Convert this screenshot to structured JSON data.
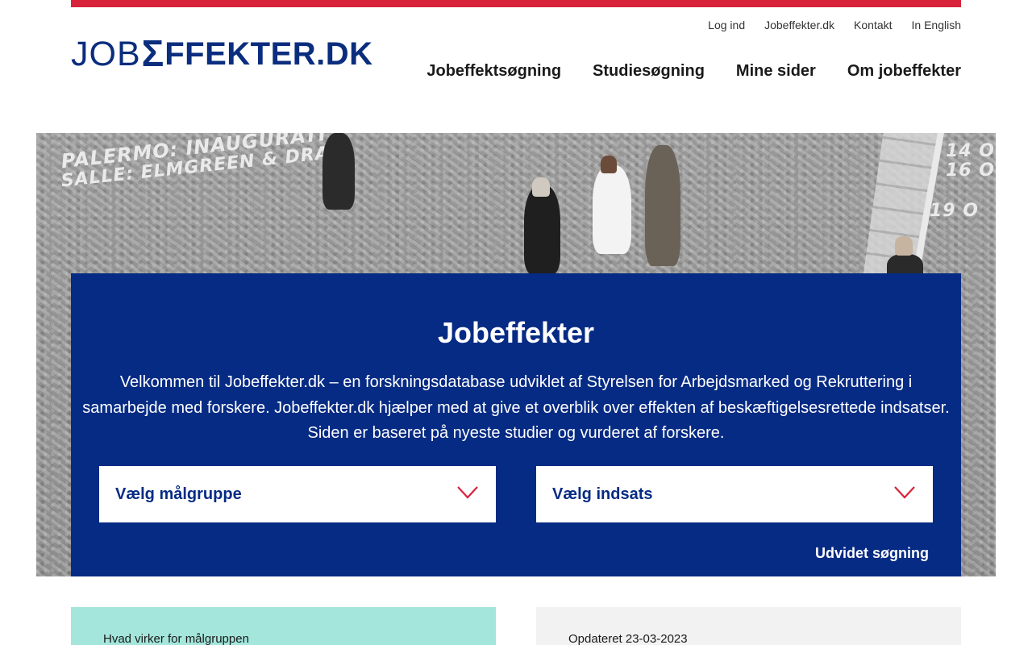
{
  "header": {
    "logo": {
      "part1": "JOB",
      "part2": "Σ",
      "part3": "FFEKTER.DK"
    },
    "util_nav": [
      "Log ind",
      "Jobeffekter.dk",
      "Kontakt",
      "In English"
    ],
    "main_nav": [
      "Jobeffektsøgning",
      "Studiesøgning",
      "Mine sider",
      "Om jobeffekter"
    ]
  },
  "hero": {
    "image_text": {
      "line1": "PALERMO: INAUGURATI",
      "line2": "SALLE: ELMGREEN & DRA",
      "r1": "14 O",
      "r2": "16 O",
      "r3": "19 O"
    },
    "title": "Jobeffekter",
    "intro": "Velkommen til Jobeffekter.dk – en forskningsdatabase udviklet af Styrelsen for Arbejdsmarked og Rekruttering i samarbejde med forskere. Jobeffekter.dk hjælper med at give et overblik over effekten af beskæftigelsesrettede indsatser. Siden er baseret på nyeste studier og vurderet af forskere.",
    "select_target": "Vælg målgruppe",
    "select_effort": "Vælg indsats",
    "advanced_search": "Udvidet søgning"
  },
  "cards": {
    "left_text": "Hvad virker for målgruppen",
    "right_text": "Opdateret 23-03-2023"
  },
  "colors": {
    "brand_blue": "#062b84",
    "accent_red": "#d7223a",
    "teal": "#a4e6dc"
  }
}
